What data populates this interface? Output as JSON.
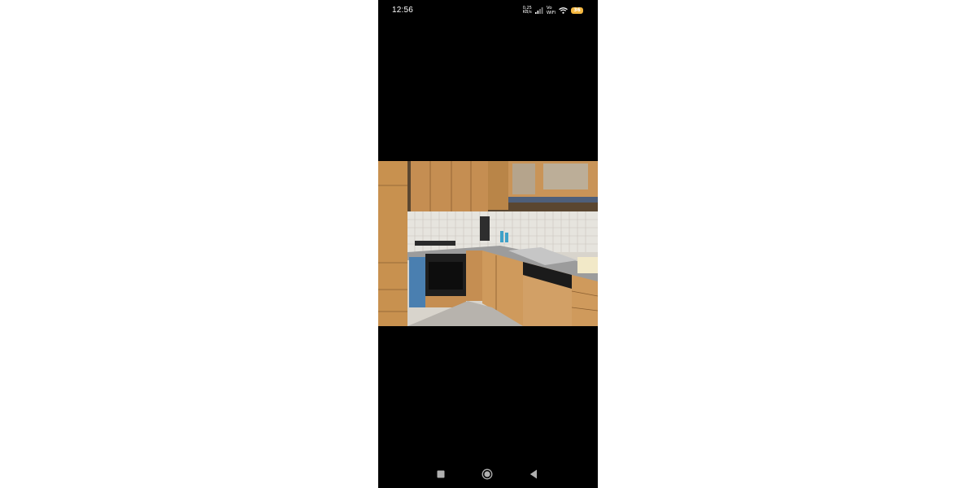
{
  "status_bar": {
    "time": "12:56",
    "net_speed_value": "0,25",
    "net_speed_unit": "KB/s",
    "vo_label": "Vo",
    "wifi_label": "WiFi",
    "battery_level": "36",
    "icons": [
      "signal-bars-icon",
      "wifi-icon",
      "battery-icon"
    ]
  },
  "viewer": {
    "image_subject": "kitchen-photo"
  },
  "nav_bar": {
    "buttons": [
      "recents-square-icon",
      "home-circle-icon",
      "back-triangle-icon"
    ]
  },
  "colors": {
    "background": "#000000",
    "page": "#ffffff",
    "battery": "#f5b841",
    "cabinet_wood": "#c58e52",
    "oven_blue": "#4a7fb0"
  }
}
